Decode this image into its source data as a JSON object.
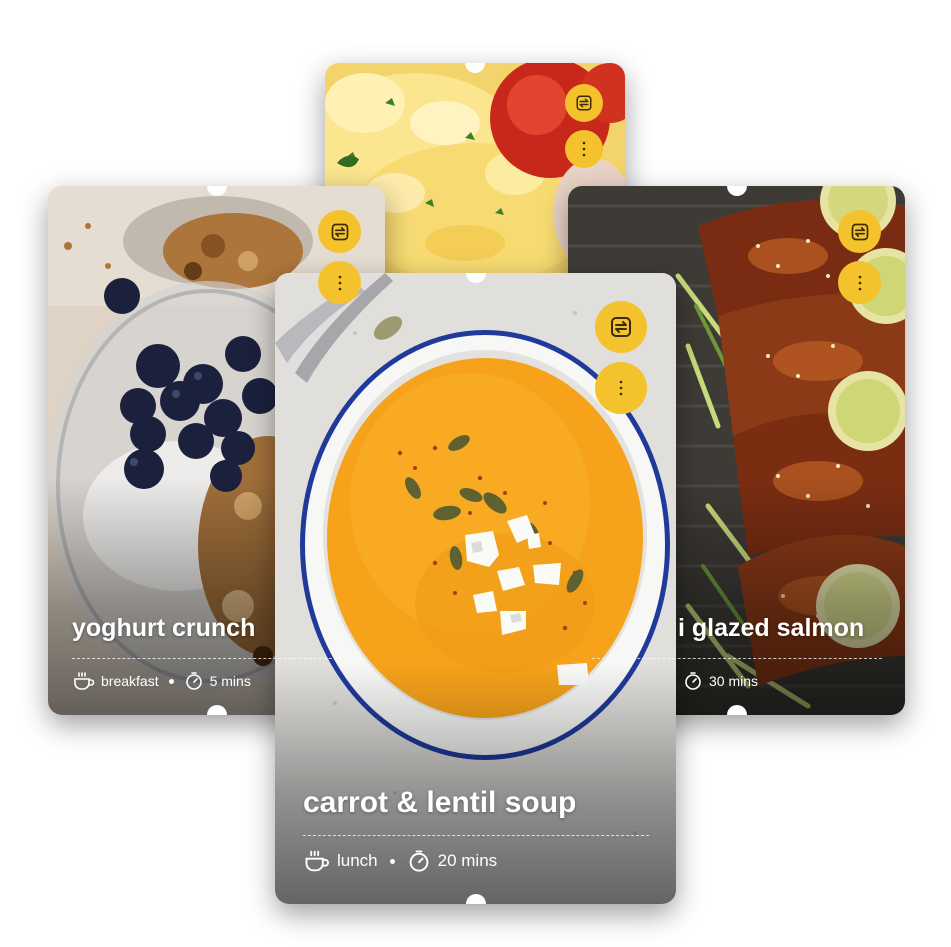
{
  "colors": {
    "accent": "#f3c22d",
    "icon": "#3a2c05",
    "text": "#ffffff"
  },
  "cards": [
    {
      "id": "back-top",
      "title": "",
      "buttons": {
        "swap_icon": "swap-arrows-icon",
        "more_icon": "more-vertical-icon"
      }
    },
    {
      "id": "left",
      "title": "yoghurt crunch",
      "meal_icon": "cup-icon",
      "meal": "breakfast",
      "time_icon": "timer-icon",
      "time": "5 mins"
    },
    {
      "id": "right",
      "title": "i glazed salmon",
      "time_icon": "timer-icon",
      "time": "30 mins"
    },
    {
      "id": "front",
      "title": "carrot & lentil soup",
      "meal_icon": "cup-icon",
      "meal": "lunch",
      "time_icon": "timer-icon",
      "time": "20 mins"
    }
  ]
}
